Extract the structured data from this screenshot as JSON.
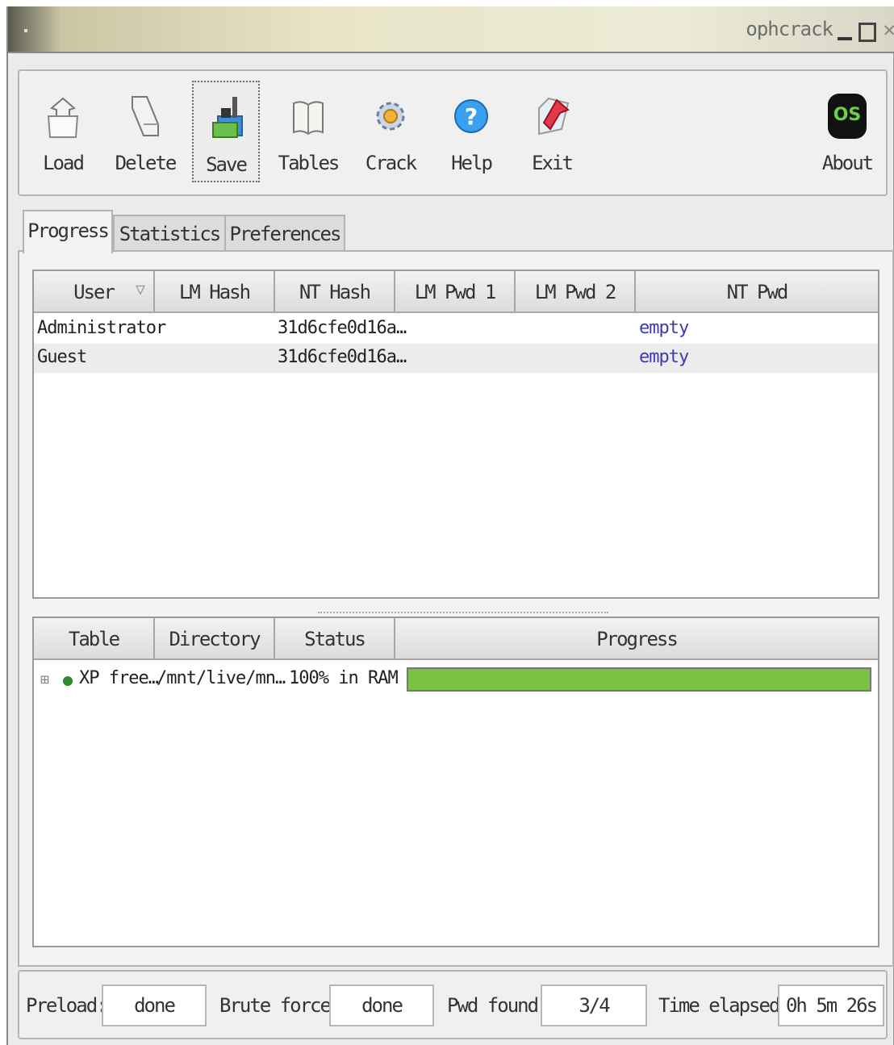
{
  "window": {
    "title": "ophcrack"
  },
  "toolbar": {
    "load": "Load",
    "delete": "Delete",
    "save": "Save",
    "tables": "Tables",
    "crack": "Crack",
    "help": "Help",
    "exit": "Exit",
    "about": "About",
    "about_logo_text": "OS"
  },
  "tabs": [
    "Progress",
    "Statistics",
    "Preferences"
  ],
  "users_table": {
    "headers": [
      "User",
      "LM Hash",
      "NT Hash",
      "LM Pwd 1",
      "LM Pwd 2",
      "NT Pwd"
    ],
    "rows": [
      {
        "user": "Administrator",
        "lm_hash": "",
        "nt_hash": "31d6cfe0d16a…",
        "lm_pwd1": "",
        "lm_pwd2": "",
        "nt_pwd": "empty"
      },
      {
        "user": "Guest",
        "lm_hash": "",
        "nt_hash": "31d6cfe0d16a…",
        "lm_pwd1": "",
        "lm_pwd2": "",
        "nt_pwd": "empty"
      }
    ]
  },
  "tables_table": {
    "headers": [
      "Table",
      "Directory",
      "Status",
      "Progress"
    ],
    "rows": [
      {
        "tree": "⊞",
        "table": "XP free…",
        "directory": "/mnt/live/mn…",
        "status": "100% in RAM",
        "progress": 1.0
      }
    ]
  },
  "status": {
    "preload_label": "Preload:",
    "preload_value": "done",
    "brute_label": "Brute force:",
    "brute_value": "done",
    "found_label": "Pwd found:",
    "found_value": "3/4",
    "elapsed_label": "Time elapsed:",
    "elapsed_value": "0h 5m 26s"
  }
}
